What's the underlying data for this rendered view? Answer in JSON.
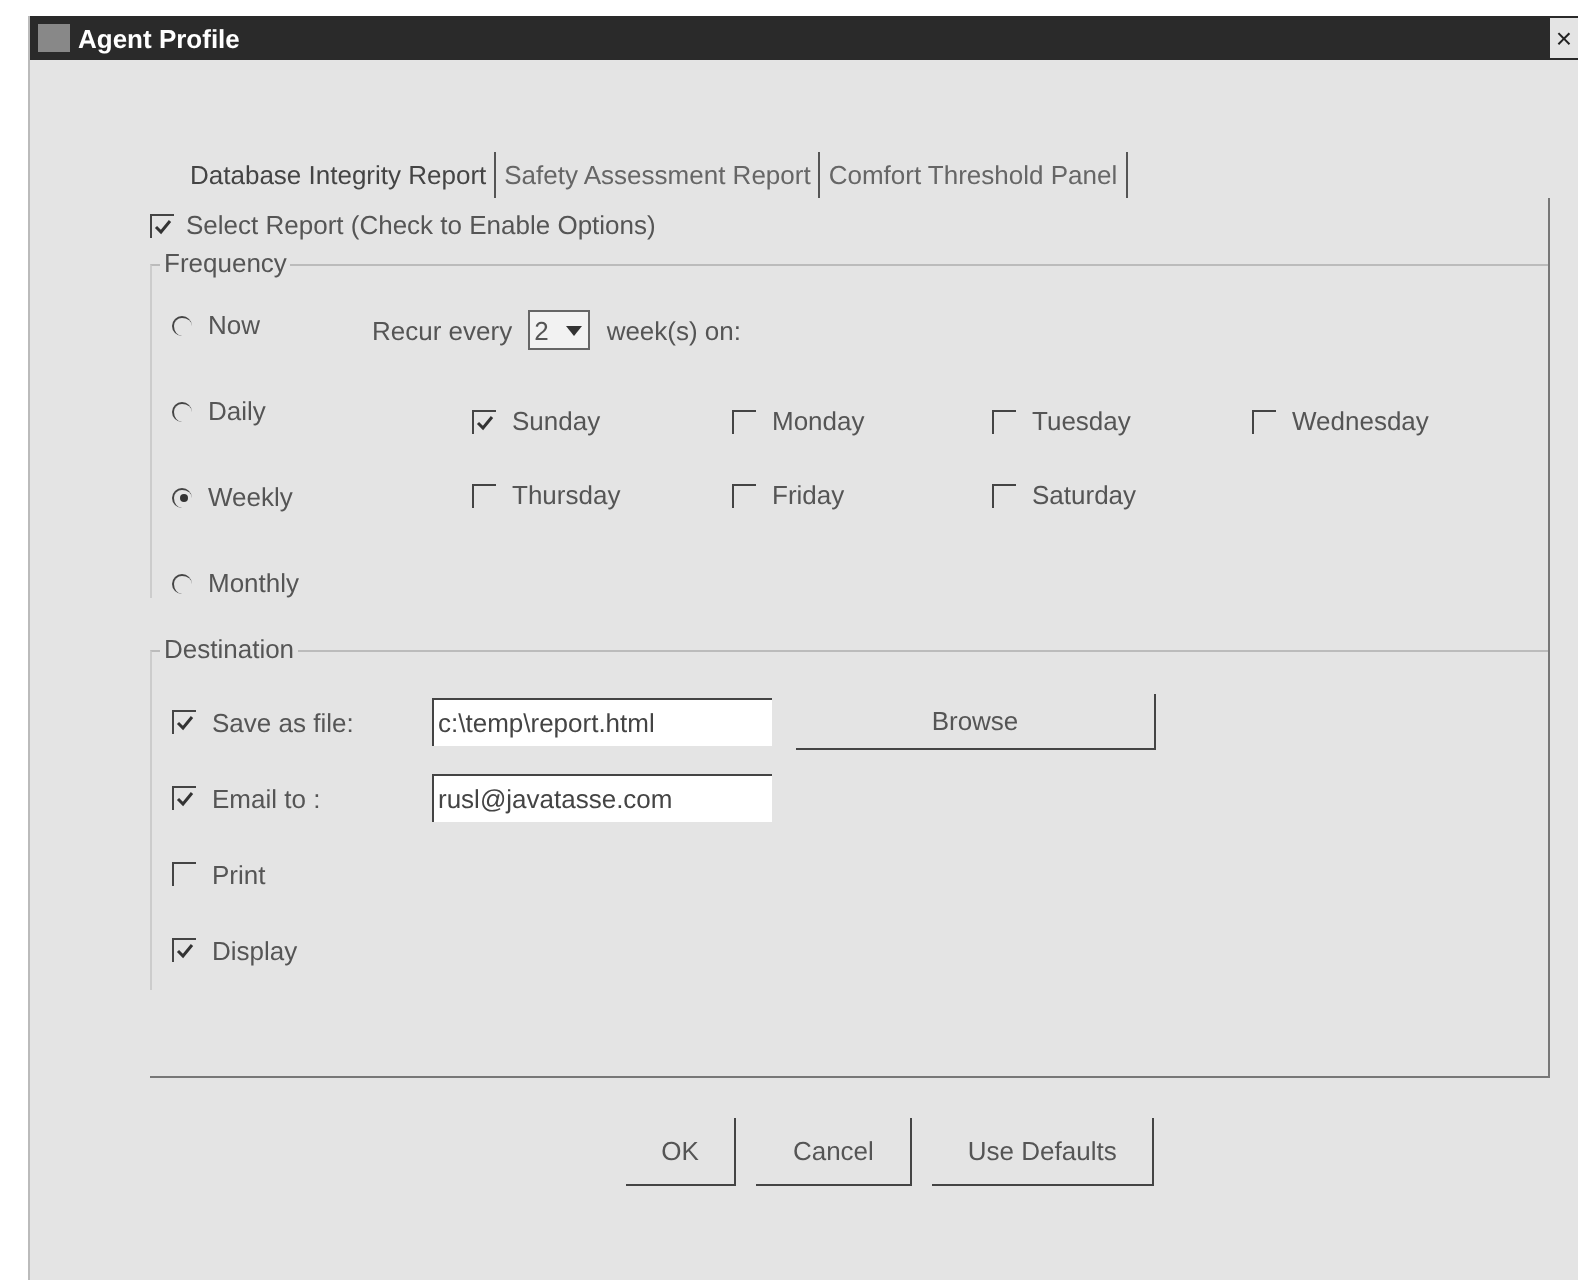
{
  "window": {
    "title": "Agent Profile",
    "close": "×"
  },
  "tabs": [
    {
      "label": "Database Integrity Report",
      "selected": true
    },
    {
      "label": "Safety Assessment Report",
      "selected": false
    },
    {
      "label": "Comfort Threshold Panel",
      "selected": false
    }
  ],
  "select_report": {
    "label": "Select Report (Check to Enable Options)",
    "checked": true
  },
  "frequency": {
    "title": "Frequency",
    "options": [
      {
        "label": "Now",
        "selected": false
      },
      {
        "label": "Daily",
        "selected": false
      },
      {
        "label": "Weekly",
        "selected": true
      },
      {
        "label": "Monthly",
        "selected": false
      }
    ],
    "recur_label": "Recur every",
    "recur_value": "2",
    "recur_suffix": "week(s) on:",
    "days": [
      {
        "label": "Sunday",
        "checked": true
      },
      {
        "label": "Monday",
        "checked": false
      },
      {
        "label": "Tuesday",
        "checked": false
      },
      {
        "label": "Wednesday",
        "checked": false
      },
      {
        "label": "Thursday",
        "checked": false
      },
      {
        "label": "Friday",
        "checked": false
      },
      {
        "label": "Saturday",
        "checked": false
      }
    ]
  },
  "destination": {
    "title": "Destination",
    "items": [
      {
        "label": "Save as file:",
        "checked": true,
        "kind": "file",
        "value": "c:\\temp\\report.html",
        "button": "Browse"
      },
      {
        "label": "Email to :",
        "checked": true,
        "kind": "text",
        "value": "rusl@javatasse.com"
      },
      {
        "label": "Print",
        "checked": false,
        "kind": "plain"
      },
      {
        "label": "Display",
        "checked": true,
        "kind": "plain"
      }
    ]
  },
  "buttons": [
    "OK",
    "Cancel",
    "Use Defaults"
  ]
}
